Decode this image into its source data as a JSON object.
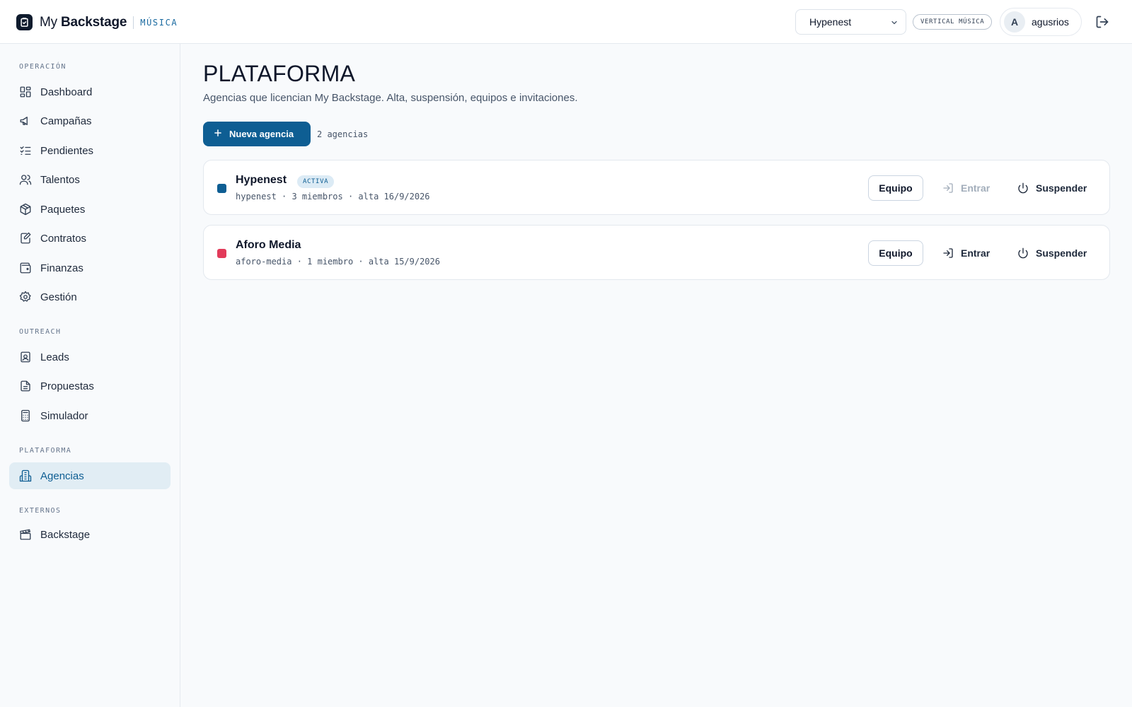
{
  "header": {
    "brand_prefix": "My ",
    "brand_bold": "Backstage",
    "brand_tag": "MÚSICA",
    "agency_select": "Hypenest",
    "vertical_badge": "VERTICAL MÚSICA",
    "avatar_initial": "A",
    "username": "agusrios"
  },
  "sidebar": {
    "sections": [
      {
        "label": "OPERACIÓN"
      },
      {
        "label": "OUTREACH"
      },
      {
        "label": "PLATAFORMA"
      },
      {
        "label": "EXTERNOS"
      }
    ],
    "items": [
      {
        "label": "Dashboard",
        "icon": "dashboard-icon"
      },
      {
        "label": "Campañas",
        "icon": "megaphone-icon"
      },
      {
        "label": "Pendientes",
        "icon": "checklist-icon"
      },
      {
        "label": "Talentos",
        "icon": "users-icon"
      },
      {
        "label": "Paquetes",
        "icon": "package-icon"
      },
      {
        "label": "Contratos",
        "icon": "contract-icon"
      },
      {
        "label": "Finanzas",
        "icon": "wallet-icon"
      },
      {
        "label": "Gestión",
        "icon": "gear-icon"
      },
      {
        "label": "Leads",
        "icon": "contact-icon"
      },
      {
        "label": "Propuestas",
        "icon": "document-icon"
      },
      {
        "label": "Simulador",
        "icon": "calculator-icon"
      },
      {
        "label": "Agencias",
        "icon": "building-icon",
        "active": true
      },
      {
        "label": "Backstage",
        "icon": "clapper-icon"
      }
    ]
  },
  "main": {
    "title": "PLATAFORMA",
    "subtitle": "Agencias que licencian My Backstage. Alta, suspensión, equipos e invitaciones.",
    "new_button": "Nueva agencia",
    "count": "2 agencias",
    "agencies": [
      {
        "name": "Hypenest",
        "status": "ACTIVA",
        "meta": "hypenest · 3 miembros · alta 16/9/2026",
        "color": "#0e5e93",
        "team_label": "Equipo",
        "enter_label": "Entrar",
        "enter_disabled": true,
        "suspend_label": "Suspender"
      },
      {
        "name": "Aforo Media",
        "status": "",
        "meta": "aforo-media · 1 miembro · alta 15/9/2026",
        "color": "#e23b5a",
        "team_label": "Equipo",
        "enter_label": "Entrar",
        "enter_disabled": false,
        "suspend_label": "Suspender"
      }
    ]
  },
  "colors": {
    "accent": "#0e5e93",
    "active_bg": "#e1edf4"
  }
}
